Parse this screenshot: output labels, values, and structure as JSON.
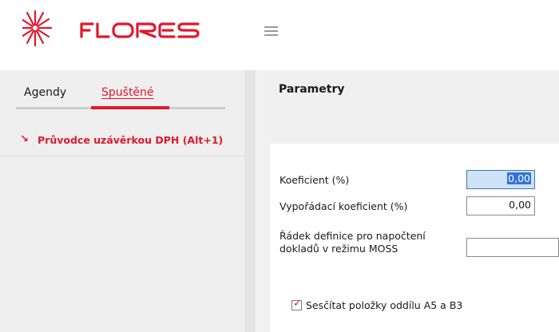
{
  "header": {
    "brand": "FLORES",
    "brand_color": "#e0182d",
    "menu_icon": "hamburger-icon"
  },
  "left_panel": {
    "tabs": [
      {
        "label": "Agendy",
        "active": false
      },
      {
        "label": "Spuštěné",
        "active": true
      }
    ],
    "running_items": [
      {
        "icon": "arrow-down-right-icon",
        "label": "Průvodce uzávěrkou DPH (Alt+1)"
      }
    ]
  },
  "right_panel": {
    "title": "Parametry",
    "fields": {
      "koeficient": {
        "label": "Koeficient (%)",
        "value": "0,00"
      },
      "vyporadaci": {
        "label": "Vypořádací koeficient (%)",
        "value": "0,00"
      },
      "radek_line1": "Řádek definice pro napočtení",
      "radek_line2": "dokladů v režimu MOSS",
      "radek_value": ""
    },
    "checkbox": {
      "label": "Sesčítat položky oddílu A5 a B3",
      "checked": true
    }
  },
  "colors": {
    "accent": "#e0182d",
    "focus_fill": "#cfe2f6",
    "selection": "#3373d8"
  }
}
